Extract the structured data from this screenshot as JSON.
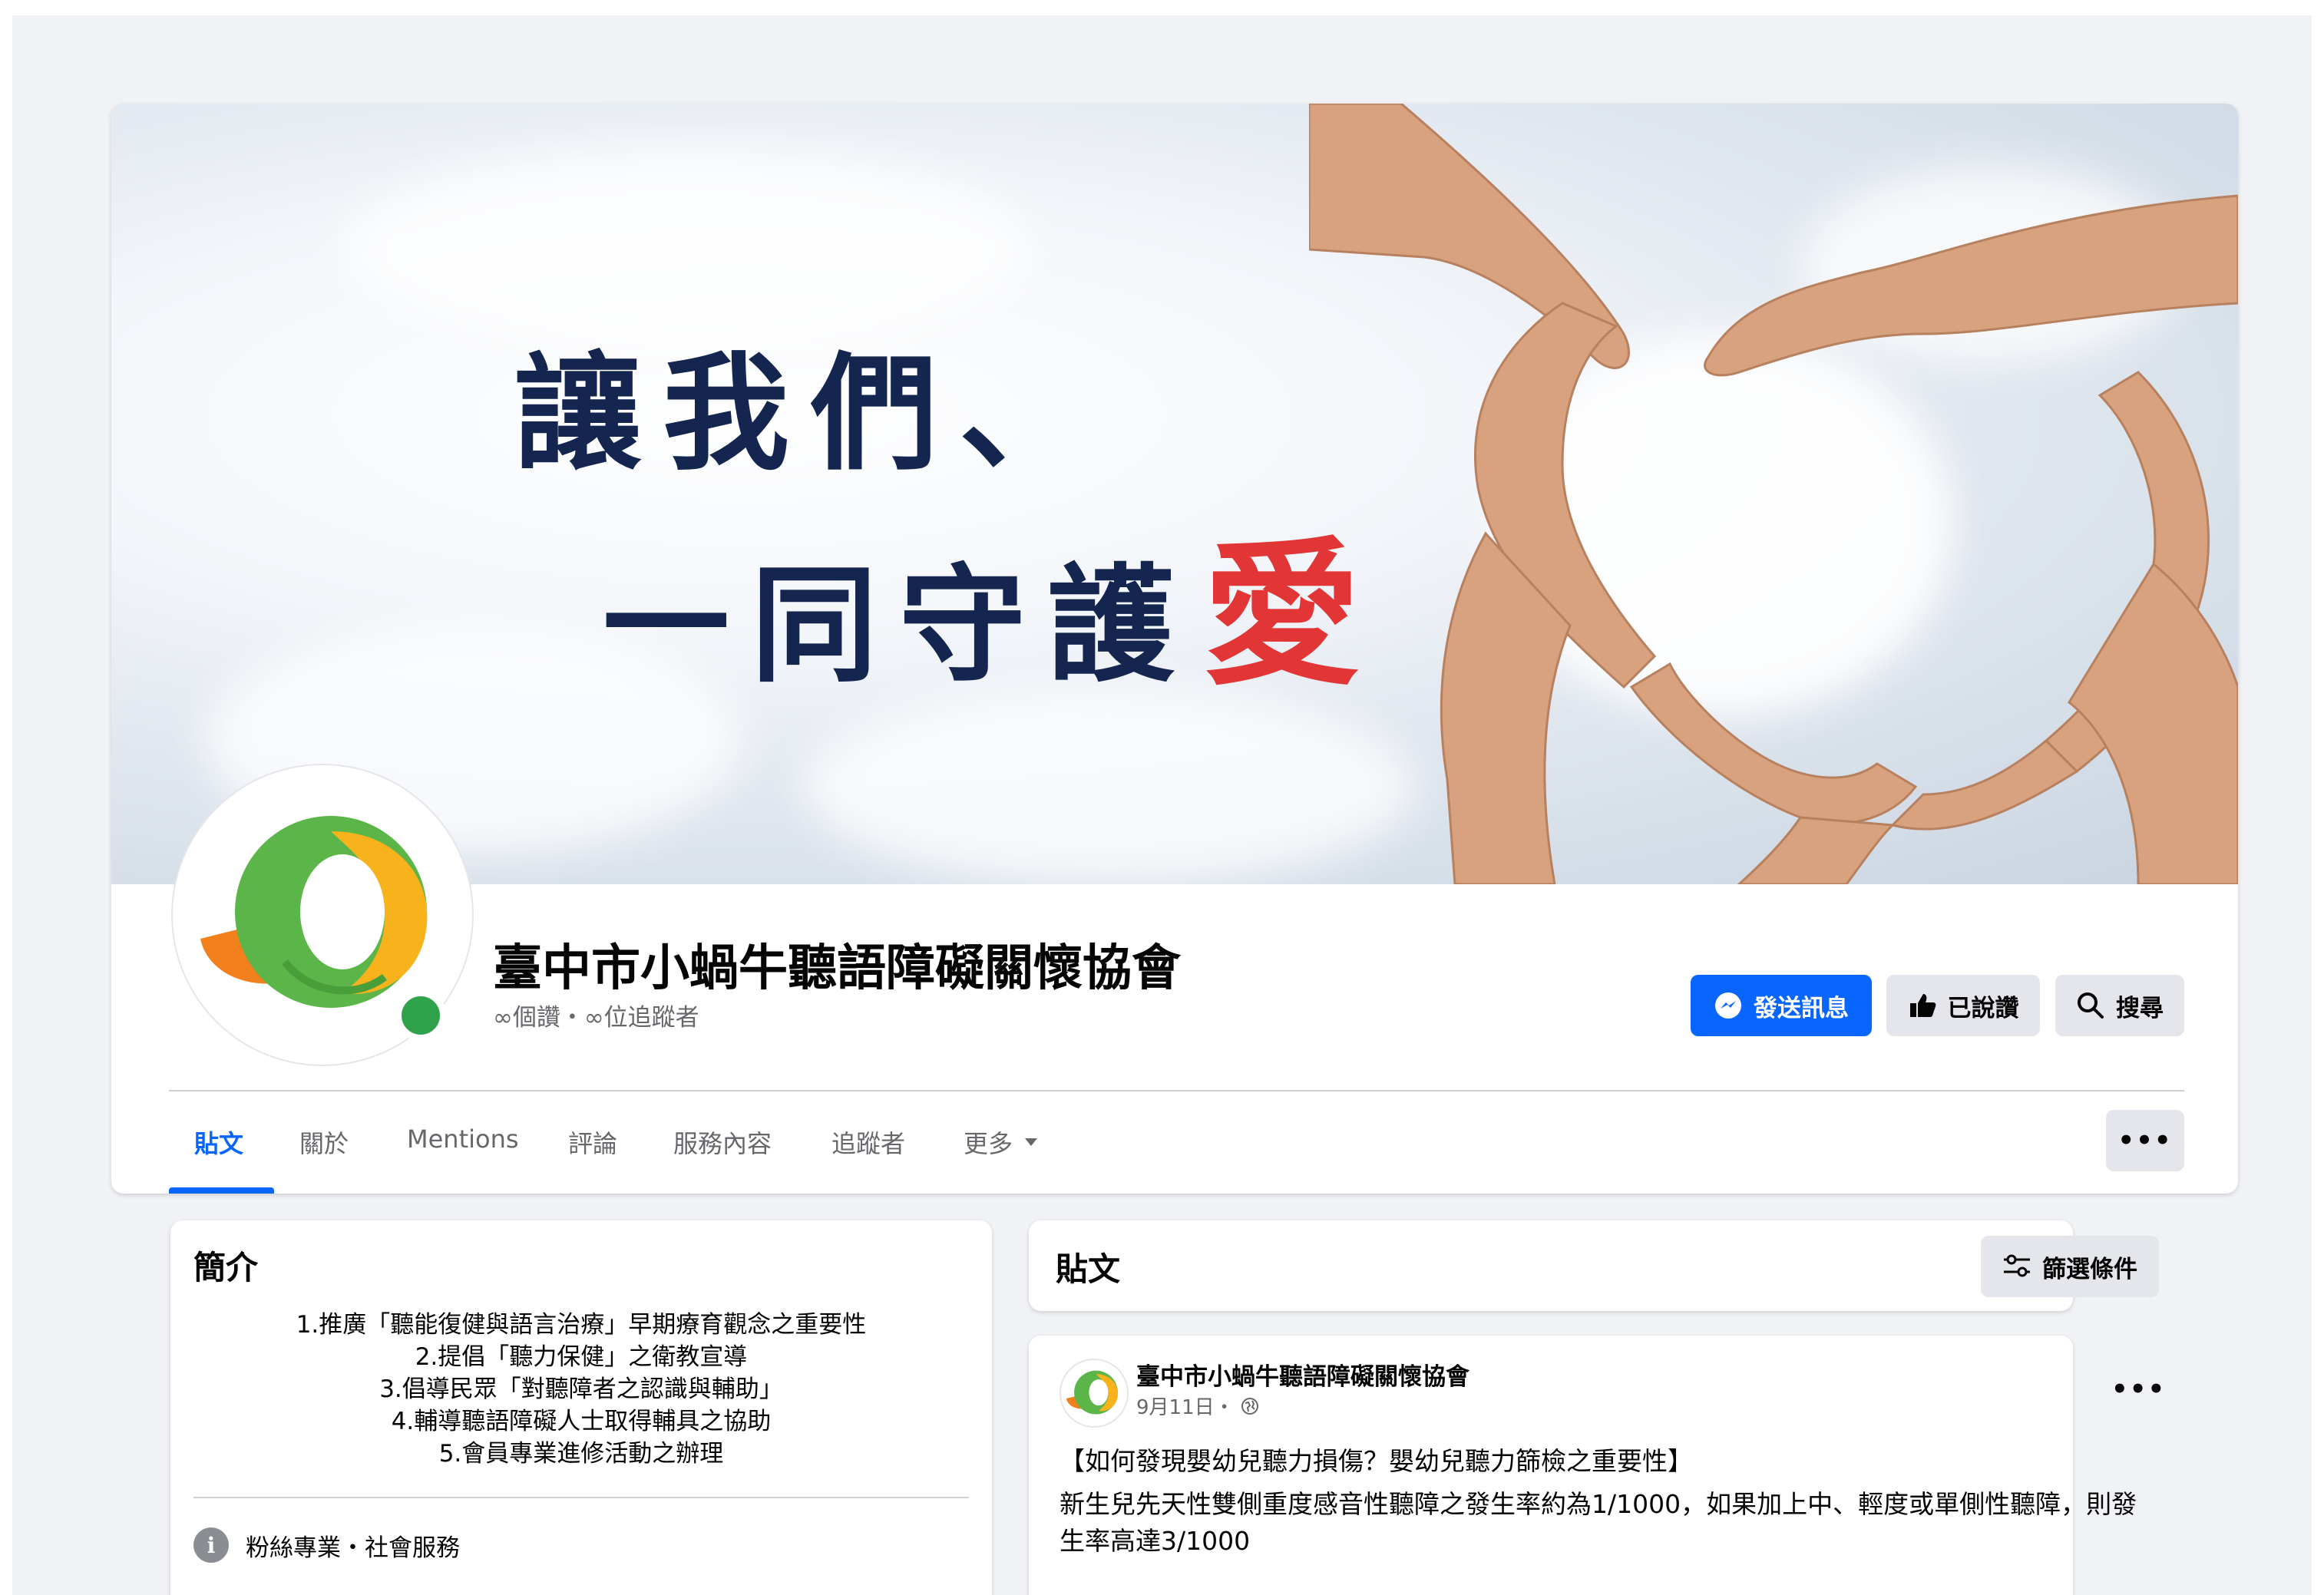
{
  "cover": {
    "line1": "讓我們、",
    "line2": "一同守護",
    "highlight": "愛",
    "text_color": "#14264f",
    "highlight_color": "#e23535"
  },
  "page": {
    "name": "臺中市小蝸牛聽語障礙關懷協會",
    "stats": "∞個讚・∞位追蹤者",
    "avatar_icon": "snail-logo-icon"
  },
  "actions": {
    "message_label": "發送訊息",
    "liked_label": "已說讚",
    "search_label": "搜尋"
  },
  "tabs": [
    {
      "label": "貼文"
    },
    {
      "label": "關於"
    },
    {
      "label": "Mentions"
    },
    {
      "label": "評論"
    },
    {
      "label": "服務內容"
    },
    {
      "label": "追蹤者"
    },
    {
      "label": "更多"
    }
  ],
  "more_options_label": "•••",
  "intro": {
    "title": "簡介",
    "lines": [
      "1.推廣「聽能復健與語言治療」早期療育觀念之重要性",
      "2.提倡「聽力保健」之衛教宣導",
      "3.倡導民眾「對聽障者之認識與輔助」",
      "4.輔導聽語障礙人士取得輔具之協助",
      "5.會員專業進修活動之辦理"
    ],
    "category": "粉絲專業・社會服務"
  },
  "posts_header": {
    "title": "貼文",
    "filter_label": "篩選條件"
  },
  "post": {
    "author": "臺中市小蝸牛聽語障礙關懷協會",
    "date": "9月11日・",
    "privacy_icon": "globe-icon",
    "more_label": "•••",
    "headline": "【如何發現嬰幼兒聽力損傷？嬰幼兒聽力篩檢之重要性】",
    "body": "新生兒先天性雙側重度感音性聽障之發生率約為1/1000，如果加上中、輕度或單側性聽障，則發生率高達3/1000"
  },
  "colors": {
    "primary": "#0866ff",
    "button_gray": "#e4e6eb",
    "secondary_text": "#65676b",
    "online_green": "#31a24c"
  }
}
